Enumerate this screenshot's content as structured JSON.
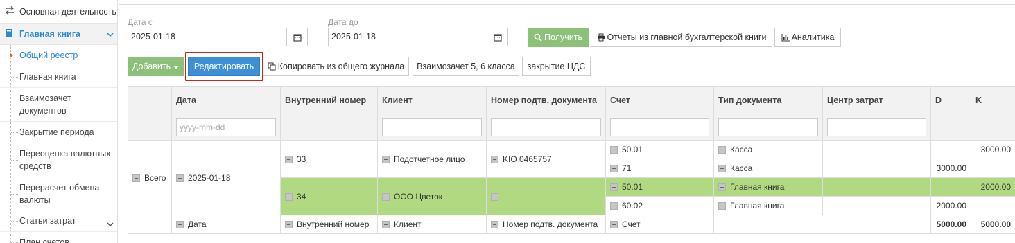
{
  "sidebar": {
    "top_label": "Основная деятельность",
    "section_label": "Главная книга",
    "items": [
      {
        "label": "Общий реестр",
        "current": true
      },
      {
        "label": "Главная книга"
      },
      {
        "label": "Взаимозачет документов"
      },
      {
        "label": "Закрытие периода"
      },
      {
        "label": "Переоценка валютных средств"
      },
      {
        "label": "Перерасчет обмена валюты"
      },
      {
        "label": "Статьи затрат"
      },
      {
        "label": "План счетов"
      }
    ]
  },
  "filters": {
    "date_from_label": "Дата с",
    "date_from_value": "2025-01-18",
    "date_to_label": "Дата до",
    "date_to_value": "2025-01-18"
  },
  "toolbar": {
    "get_label": "Получить",
    "reports_label": "Отчеты из главной бухгалтерской книги",
    "analytics_label": "Аналитика",
    "add_label": "Добавить",
    "edit_label": "Редактировать",
    "copy_label": "Копировать из общего журнала",
    "offset_label": "Взаимозачет 5, 6 класса",
    "vat_label": "закрытие НДС"
  },
  "table": {
    "headers": [
      "",
      "Дата",
      "Внутренний номер",
      "Клиент",
      "Номер подтв. документа",
      "Счет",
      "Тип документа",
      "Центр затрат",
      "D",
      "K"
    ],
    "date_placeholder": "yyyy-mm-dd",
    "group_label": "Всего",
    "group_date": "2025-01-18",
    "docs": [
      {
        "number": "33",
        "client": "Подотчетное лицо",
        "doc_no": "KIO 0465757",
        "lines": [
          {
            "account": "50.01",
            "type": "Касса",
            "d": "",
            "k": "3000.00"
          },
          {
            "account": "71",
            "type": "Касса",
            "d": "3000.00",
            "k": ""
          }
        ]
      },
      {
        "number": "34",
        "client": "ООО Цветок",
        "doc_no": "",
        "lines": [
          {
            "account": "50.01",
            "type": "Главная книга",
            "d": "",
            "k": "2000.00"
          },
          {
            "account": "60.02",
            "type": "Главная книга",
            "d": "2000.00",
            "k": ""
          }
        ]
      }
    ],
    "footer": {
      "date": "Дата",
      "number": "Внутренний номер",
      "client": "Клиент",
      "doc_no": "Номер подтв. документа",
      "account": "Счет",
      "d_total": "5000.00",
      "k_total": "5000.00"
    }
  },
  "colors": {
    "accent": "#3d8fd6",
    "green_button": "#8bc178",
    "highlight_row": "#b0d982",
    "annotation": "#d71f1f"
  }
}
